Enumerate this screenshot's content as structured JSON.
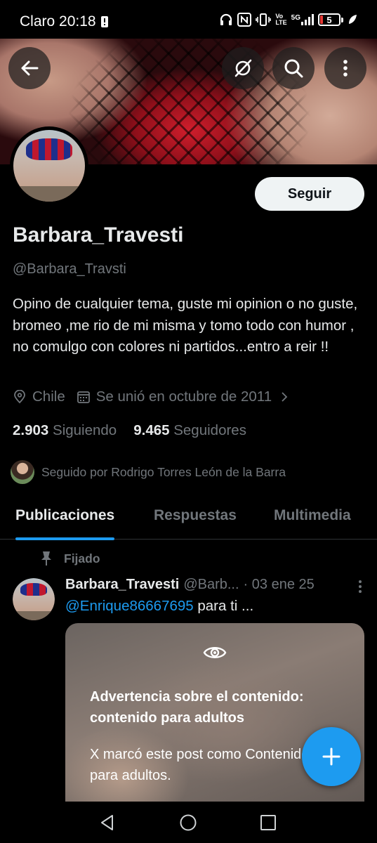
{
  "status_bar": {
    "carrier_time": "Claro 20:18",
    "network_top": "Vo",
    "network_bottom": "LTE",
    "signal_label": "5G",
    "battery_level": "5"
  },
  "profile": {
    "display_name": "Barbara_Travesti",
    "handle": "@Barbara_Travsti",
    "follow_label": "Seguir",
    "bio": "Opino de cualquier tema, guste mi opinion o no guste, bromeo ,me rio de mi misma y tomo todo con humor , no comulgo con colores ni partidos...entro a reir !!",
    "location": "Chile",
    "joined": "Se unió en octubre de 2011",
    "following_count": "2.903",
    "following_label": "Siguiendo",
    "followers_count": "9.465",
    "followers_label": "Seguidores",
    "followed_by": "Seguido por Rodrigo Torres León de la Barra"
  },
  "tabs": [
    {
      "label": "Publicaciones",
      "active": true
    },
    {
      "label": "Respuestas",
      "active": false
    },
    {
      "label": "Multimedia",
      "active": false
    }
  ],
  "post": {
    "pinned_label": "Fijado",
    "author_name": "Barbara_Travesti",
    "author_handle": "@Barb...",
    "date": "· 03 ene 25",
    "mention": "@Enrique86667695",
    "text_rest": " para ti ...",
    "warning_title": "Advertencia sobre el contenido: contenido para adultos",
    "warning_body": "X marcó este post como Contenido para adultos."
  },
  "icons": {
    "back": "arrow-left-icon",
    "grok": "grok-icon",
    "search": "search-icon",
    "more": "more-vertical-icon",
    "location": "location-pin-icon",
    "calendar": "calendar-icon",
    "pin": "pin-icon",
    "eye": "eye-icon",
    "compose": "plus-icon"
  },
  "colors": {
    "accent": "#1d9bf0",
    "background": "#000000",
    "text_primary": "#e7e9ea",
    "text_secondary": "#71767b"
  }
}
